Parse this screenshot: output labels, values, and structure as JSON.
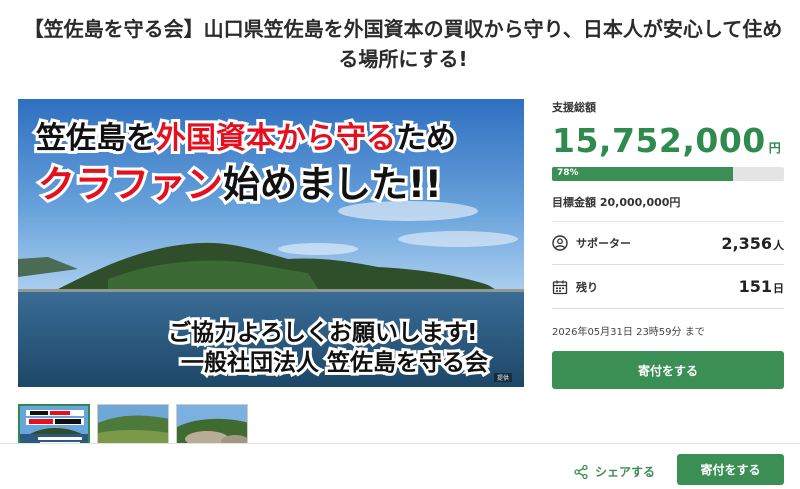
{
  "page": {
    "title": "【笠佐島を守る会】山口県笠佐島を外国資本の買収から守り、日本人が安心して住める場所にする!"
  },
  "hero": {
    "line1_a": "笠佐島を",
    "line1_b": "外国資本から守る",
    "line1_c": "ため",
    "line2_a": "クラファン",
    "line2_b": "始めました!!",
    "line3": "ご協力よろしくお願いします!",
    "line4": "一般社団法人 笠佐島を守る会",
    "credit": "提供"
  },
  "thumbnails": [
    "thumbnail-1",
    "thumbnail-2",
    "thumbnail-3"
  ],
  "funding": {
    "total_label": "支援総額",
    "total_value": "15,752,000",
    "total_unit": "円",
    "percent": 78,
    "percent_label": "78%",
    "goal_label": "目標金額 20,000,000円"
  },
  "stats": {
    "supporters_label": "サポーター",
    "supporters_value": "2,356",
    "supporters_unit": "人",
    "remaining_label": "残り",
    "remaining_value": "151",
    "remaining_unit": "日"
  },
  "deadline": "2026年05月31日 23時59分 まで",
  "buttons": {
    "donate_label": "寄付をする",
    "share_label": "シェアする",
    "footer_donate_label": "寄付をする"
  },
  "colors": {
    "accent": "#3b8f55",
    "accent_text": "#2f8a4e",
    "hero_red": "#e60f1e"
  },
  "icons": {
    "supporters": "user-circle-icon",
    "remaining": "calendar-icon",
    "share": "share-icon"
  }
}
